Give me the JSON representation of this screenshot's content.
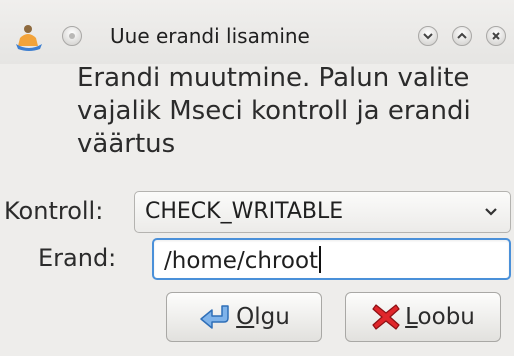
{
  "window": {
    "title": "Uue erandi lisamine",
    "icons": [
      "app-icon",
      "menu-icon",
      "minimize-icon",
      "maximize-icon",
      "close-icon"
    ]
  },
  "message": "Erandi muutmine. Palun valite vajalik Mseci kontroll ja erandi väärtus",
  "form": {
    "kontroll_label": "Kontroll:",
    "kontroll_value": "CHECK_WRITABLE",
    "erand_label": "Erand:",
    "erand_value": "/home/chroot"
  },
  "buttons": {
    "ok": {
      "mnemonic": "O",
      "rest": "lgu",
      "icon": "return-arrow-icon"
    },
    "cancel": {
      "mnemonic": "L",
      "rest": "oobu",
      "icon": "cancel-x-icon"
    }
  },
  "colors": {
    "focus": "#4a90d9",
    "cancel_icon": "#e0262b",
    "ok_icon": "#4a8fd8"
  }
}
